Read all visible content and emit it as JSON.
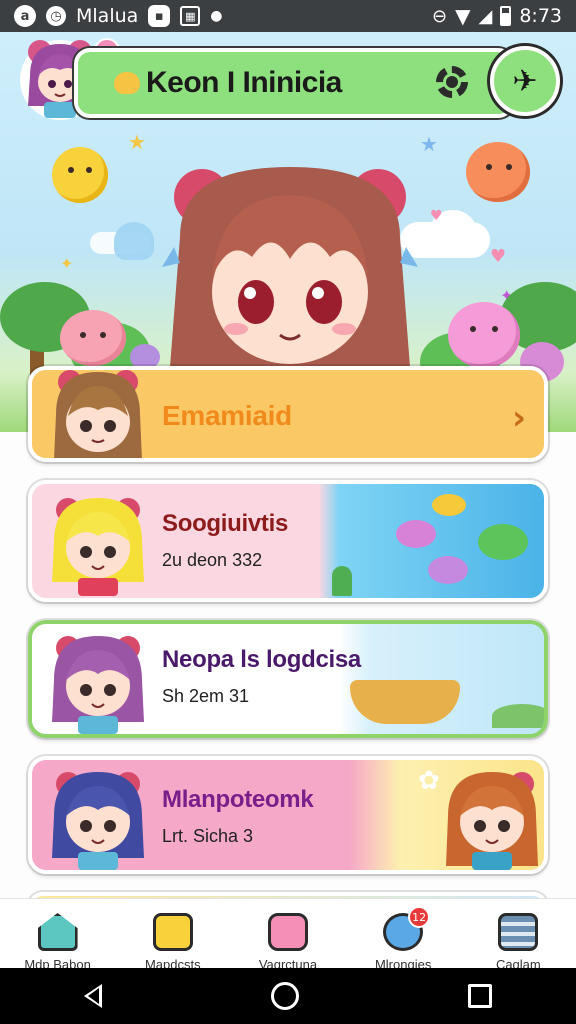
{
  "status_bar": {
    "app_title": "Mlalua",
    "time": "8:73"
  },
  "header": {
    "title": "Keon I Ininicia"
  },
  "list": {
    "items": [
      {
        "title": "Emamiaid",
        "subtitle": "",
        "color": "#f4a93a"
      },
      {
        "title": "Soogiuivtis",
        "subtitle": "2u deon 332",
        "color": "#8c1c1c"
      },
      {
        "title": "Neopa ls logdcisa",
        "subtitle": "Sh 2em 31",
        "color": "#4a1a6a"
      },
      {
        "title": "Mlanpoteomk",
        "subtitle": "Lrt. Sicha 3",
        "color": "#7a1e8a"
      }
    ]
  },
  "bottom_nav": {
    "items": [
      {
        "label": "Mdp Babon",
        "icon": "house-icon"
      },
      {
        "label": "Mapdcsts",
        "icon": "puzzle-icon"
      },
      {
        "label": "Vagrctuna",
        "icon": "face-icon"
      },
      {
        "label": "Mlrongies",
        "icon": "chat-bubble-icon",
        "badge": "12"
      },
      {
        "label": "Caglam",
        "icon": "list-icon"
      }
    ]
  }
}
